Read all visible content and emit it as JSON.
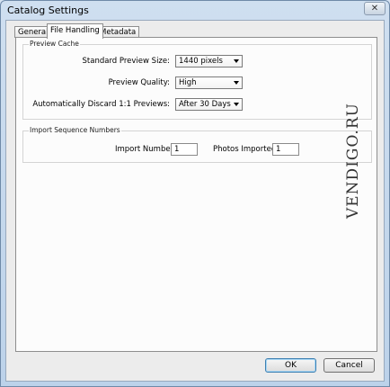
{
  "window": {
    "title": "Catalog Settings"
  },
  "tabs": [
    {
      "label": "General"
    },
    {
      "label": "File Handling"
    },
    {
      "label": "Metadata"
    }
  ],
  "preview_cache": {
    "title": "Preview Cache",
    "standard_size_label": "Standard Preview Size:",
    "standard_size_value": "1440 pixels",
    "quality_label": "Preview Quality:",
    "quality_value": "High",
    "discard_label": "Automatically Discard 1:1 Previews:",
    "discard_value": "After 30 Days"
  },
  "import_sequence": {
    "title": "Import Sequence Numbers",
    "import_number_label": "Import Number:",
    "import_number_value": "1",
    "photos_imported_label": "Photos Imported:",
    "photos_imported_value": "1"
  },
  "watermark": "VENDIGO.RU",
  "buttons": {
    "ok": "OK",
    "cancel": "Cancel"
  }
}
